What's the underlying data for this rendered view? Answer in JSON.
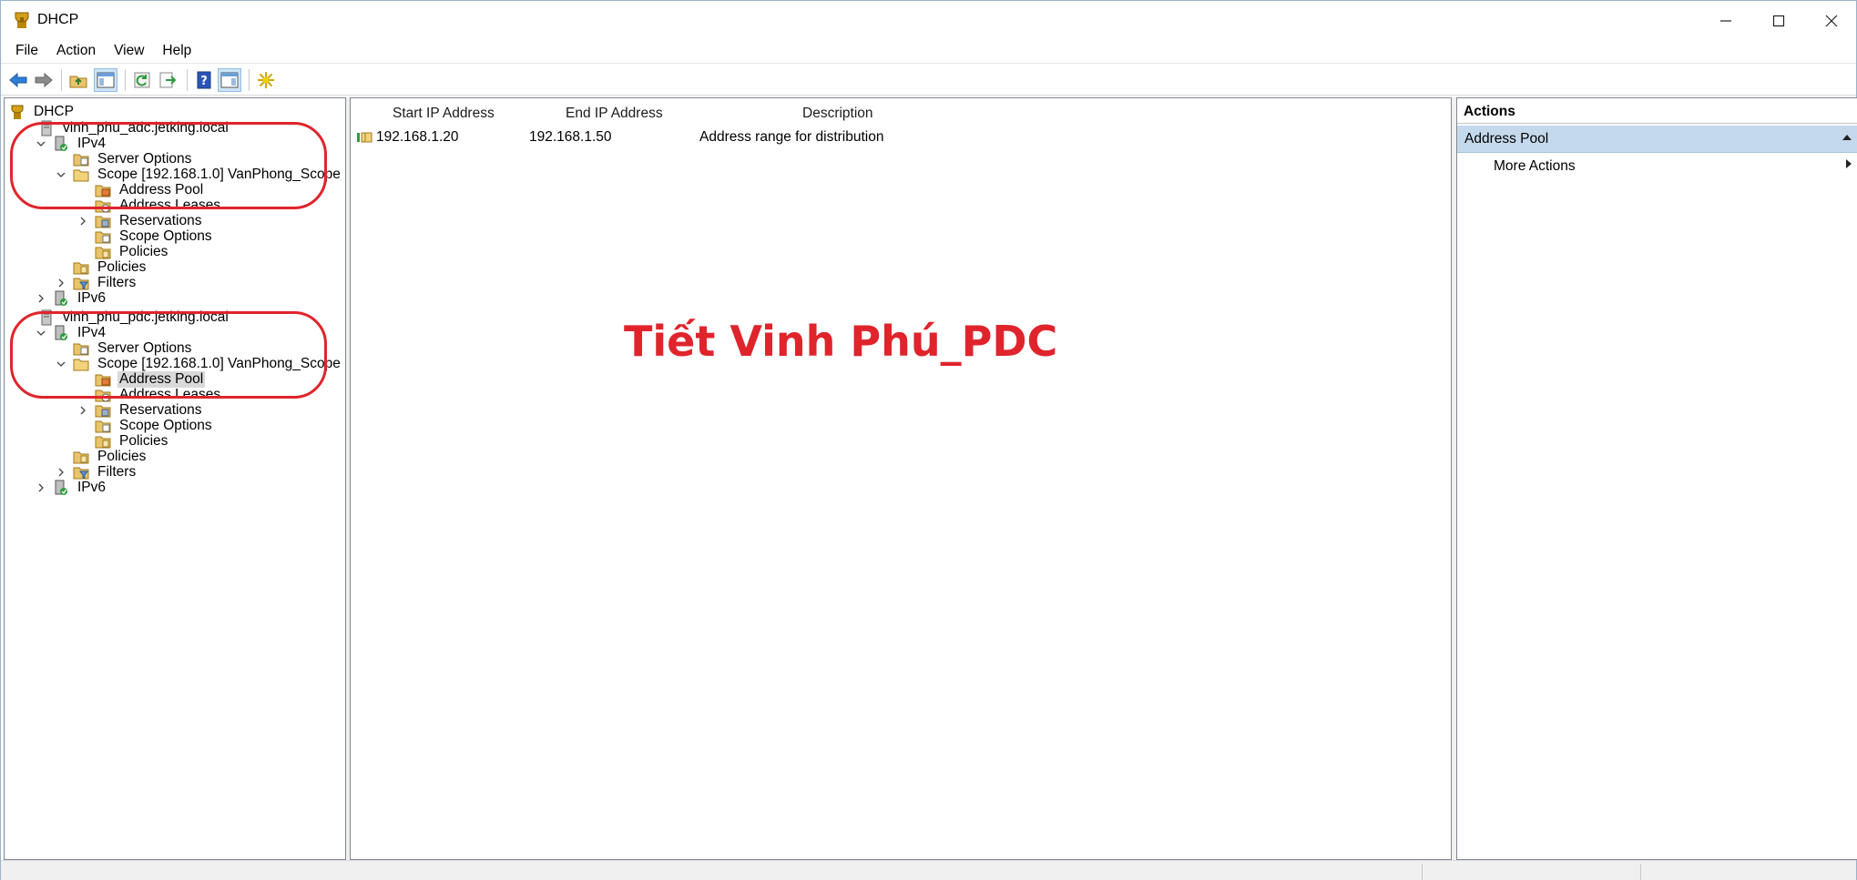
{
  "window": {
    "title": "DHCP"
  },
  "menu": [
    "File",
    "Action",
    "View",
    "Help"
  ],
  "toolbar": {
    "icons": [
      "back-arrow-icon",
      "forward-arrow-icon",
      "up-folder-icon",
      "show-hide-console-tree-icon",
      "refresh-icon",
      "export-list-icon",
      "help-icon",
      "show-hide-action-pane-icon",
      "new-star-icon"
    ]
  },
  "tree": {
    "root": "DHCP",
    "servers": [
      {
        "name": "vinh_phu_adc.jetking.local",
        "ipv4": "IPv4",
        "server_options": "Server Options",
        "scope": "Scope [192.168.1.0] VanPhong_Scope",
        "scope_children": [
          "Address Pool",
          "Address Leases",
          "Reservations",
          "Scope Options",
          "Policies"
        ],
        "policies": "Policies",
        "filters": "Filters",
        "ipv6": "IPv6"
      },
      {
        "name": "vinh_phu_pdc.jetking.local",
        "ipv4": "IPv4",
        "server_options": "Server Options",
        "scope": "Scope [192.168.1.0] VanPhong_Scope",
        "scope_children": [
          "Address Pool",
          "Address Leases",
          "Reservations",
          "Scope Options",
          "Policies"
        ],
        "policies": "Policies",
        "filters": "Filters",
        "ipv6": "IPv6"
      }
    ]
  },
  "list": {
    "columns": [
      "Start IP Address",
      "End IP Address",
      "Description"
    ],
    "rows": [
      {
        "start": "192.168.1.20",
        "end": "192.168.1.50",
        "description": "Address range for distribution"
      }
    ]
  },
  "watermark": "Tiết Vinh Phú_PDC",
  "actions": {
    "header": "Actions",
    "section": "Address Pool",
    "item": "More Actions"
  },
  "colors": {
    "annotation_red": "#e0242c",
    "actions_section_bg": "#c5d9ec"
  }
}
